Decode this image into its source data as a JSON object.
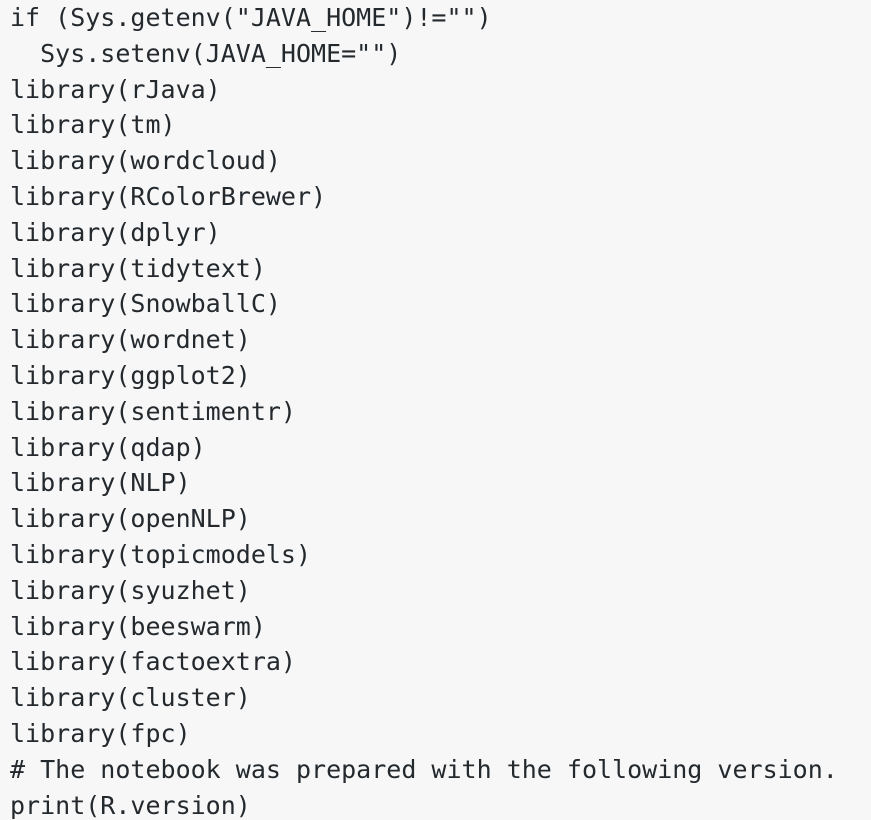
{
  "code": {
    "lines": [
      "if (Sys.getenv(\"JAVA_HOME\")!=\"\")",
      "  Sys.setenv(JAVA_HOME=\"\")",
      "library(rJava)",
      "library(tm)",
      "library(wordcloud)",
      "library(RColorBrewer)",
      "library(dplyr)",
      "library(tidytext)",
      "library(SnowballC)",
      "library(wordnet)",
      "library(ggplot2)",
      "library(sentimentr)",
      "library(qdap)",
      "library(NLP)",
      "library(openNLP)",
      "library(topicmodels)",
      "library(syuzhet)",
      "library(beeswarm)",
      "library(factoextra)",
      "library(cluster)",
      "library(fpc)",
      "# The notebook was prepared with the following version.",
      "print(R.version)"
    ]
  }
}
